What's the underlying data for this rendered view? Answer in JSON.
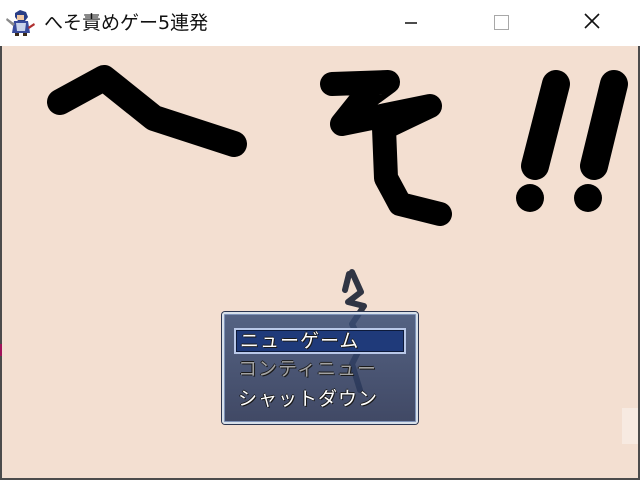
{
  "window": {
    "title": "へそ責めゲー5連発",
    "icon": "game-character-icon",
    "controls": {
      "minimize_icon": "minimize-icon",
      "maximize_icon": "maximize-icon",
      "close_icon": "close-icon"
    }
  },
  "title_screen": {
    "logo_text": "へそ!!",
    "background_color": "#f3dfd1",
    "logo_color": "#000000",
    "commands": [
      {
        "label": "ニューゲーム",
        "selected": true,
        "enabled": true
      },
      {
        "label": "コンティニュー",
        "selected": false,
        "enabled": false
      },
      {
        "label": "シャットダウン",
        "selected": false,
        "enabled": true
      }
    ]
  },
  "colors": {
    "window_fill": "#3a4e76",
    "window_border": "#d7e0ea",
    "selection": "#1f3a7a"
  }
}
